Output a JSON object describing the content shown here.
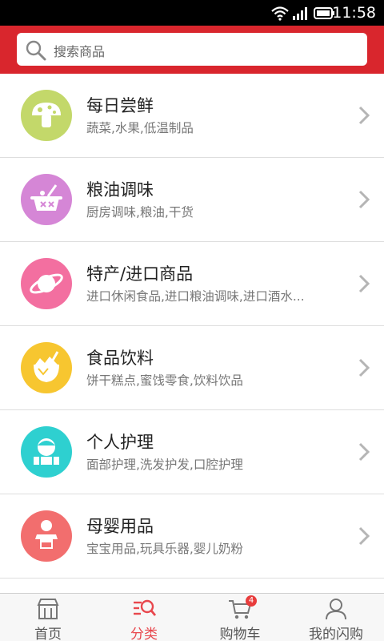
{
  "status_bar": {
    "time": "11:58"
  },
  "search": {
    "placeholder": "搜索商品"
  },
  "categories": [
    {
      "title": "每日尝鲜",
      "subtitle": "蔬菜,水果,低温制品",
      "icon": "mushroom-icon",
      "color": "#c3d86a"
    },
    {
      "title": "粮油调味",
      "subtitle": "厨房调味,粮油,干货",
      "icon": "cooking-pot-icon",
      "color": "#d586d6"
    },
    {
      "title": "特产/进口商品",
      "subtitle": "进口休闲食品,进口粮油调味,进口酒水...",
      "icon": "planet-icon",
      "color": "#f36fa0"
    },
    {
      "title": "食品饮料",
      "subtitle": "饼干糕点,蜜饯零食,饮料饮品",
      "icon": "coconut-drink-icon",
      "color": "#f7c630"
    },
    {
      "title": "个人护理",
      "subtitle": "面部护理,洗发护发,口腔护理",
      "icon": "person-care-icon",
      "color": "#2ed0d0"
    },
    {
      "title": "母婴用品",
      "subtitle": "宝宝用品,玩具乐器,婴儿奶粉",
      "icon": "baby-icon",
      "color": "#f26e6e"
    }
  ],
  "tabs": [
    {
      "label": "首页",
      "icon": "storefront-icon",
      "active": false
    },
    {
      "label": "分类",
      "icon": "category-search-icon",
      "active": true
    },
    {
      "label": "购物车",
      "icon": "cart-icon",
      "active": false,
      "badge": "4"
    },
    {
      "label": "我的闪购",
      "icon": "user-icon",
      "active": false
    }
  ],
  "colors": {
    "header": "#d9262d",
    "active_tab": "#e8474d"
  }
}
